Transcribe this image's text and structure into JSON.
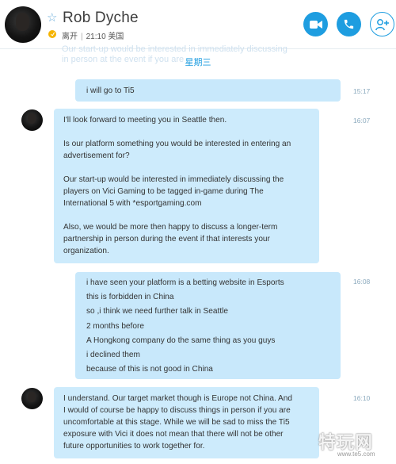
{
  "header": {
    "contact_name": "Rob Dyche",
    "status_text": "离开",
    "status_time": "21:10 美国"
  },
  "faded_lines": [
    "Our start-up would be interested in immediately discussing",
    "in person at the event if you are"
  ],
  "day_separator": "星期三",
  "messages": [
    {
      "sender": "me",
      "time": "15:17",
      "lines": [
        "i will go to Ti5"
      ]
    },
    {
      "sender": "them",
      "time": "16:07",
      "paragraphs": [
        [
          "I'll look forward to meeting you in Seattle then."
        ],
        [
          "Is our platform something you would be interested in entering an",
          "advertisement for?"
        ],
        [
          "Our start-up would be interested in immediately discussing the",
          "players on Vici Gaming to be tagged in-game during The",
          "International 5 with *esportgaming.com"
        ],
        [
          "Also, we would be more then happy to discuss a longer-term",
          "partnership in person during the event if that interests your",
          "organization."
        ]
      ]
    },
    {
      "sender": "me",
      "time": "16:08",
      "lines": [
        "i have seen your platform is a betting website in Esports",
        "this is forbidden in China",
        "so ,i think we need further talk in Seattle",
        "2 months before",
        "A Hongkong company do the same thing as you guys",
        "i declined them",
        "because of this is not good in China"
      ]
    },
    {
      "sender": "them",
      "time": "16:10",
      "lines": [
        "I understand. Our target market though is Europe not China.  And",
        "I would of course be happy to discuss things in person if you are",
        "uncomfortable at this stage. While we will be sad to miss the Ti5",
        "exposure with Vici it does not mean that there will not be other",
        "future opportunities to work together for."
      ]
    }
  ],
  "watermark": {
    "main": "特玩网",
    "sub": "www.te5.com"
  },
  "colors": {
    "accent": "#1e9de0",
    "bubble": "#c8e8fb",
    "away": "#f5b400"
  },
  "icons": [
    "star-icon",
    "away-status-icon",
    "video-call-icon",
    "phone-call-icon",
    "add-person-icon"
  ]
}
